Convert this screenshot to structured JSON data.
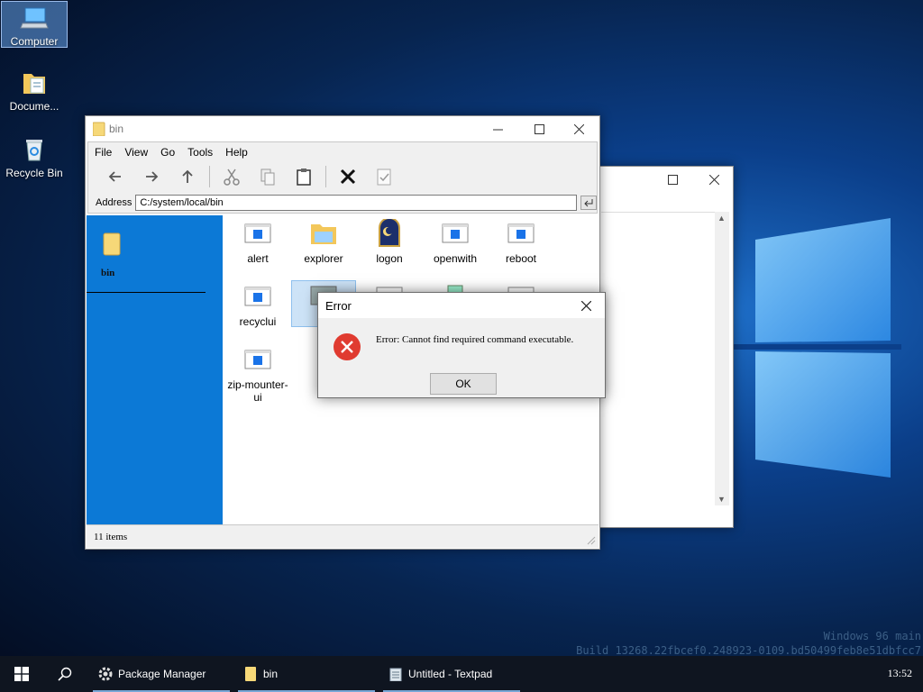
{
  "desktop": {
    "icons": [
      {
        "label": "Computer"
      },
      {
        "label": "Docume..."
      },
      {
        "label": "Recycle Bin"
      }
    ]
  },
  "explorer": {
    "title": "bin",
    "menu": [
      "File",
      "View",
      "Go",
      "Tools",
      "Help"
    ],
    "address_label": "Address",
    "address_value": "C:/system/local/bin",
    "sidebar_label": "bin",
    "files": [
      {
        "name": "alert",
        "icon": "app-window-icon"
      },
      {
        "name": "explorer",
        "icon": "folder-icon"
      },
      {
        "name": "logon",
        "icon": "moon-logon-icon"
      },
      {
        "name": "openwith",
        "icon": "app-window-icon"
      },
      {
        "name": "reboot",
        "icon": "app-window-icon"
      },
      {
        "name": "recyclui",
        "icon": "app-window-icon"
      },
      {
        "name": "zip-mounter-ui",
        "icon": "app-window-icon"
      }
    ],
    "status": "11 items"
  },
  "dialog": {
    "title": "Error",
    "message": "Error: Cannot find required command executable.",
    "ok_label": "OK"
  },
  "watermark": {
    "line1": "Windows 96 main",
    "line2": "Build 13268.22fbcef0.248923-0109.bd50499feb8e51dbfcc7"
  },
  "taskbar": {
    "tasks": [
      {
        "label": "Package Manager",
        "icon": "package-manager-icon"
      },
      {
        "label": "bin",
        "icon": "folder-icon"
      },
      {
        "label": "Untitled - Textpad",
        "icon": "notepad-icon"
      }
    ],
    "clock": "13:52"
  },
  "colors": {
    "sidebar": "#0c79d6",
    "taskbar": "#0f1520",
    "selection": "#cde3f7",
    "error_red": "#e03b30"
  }
}
